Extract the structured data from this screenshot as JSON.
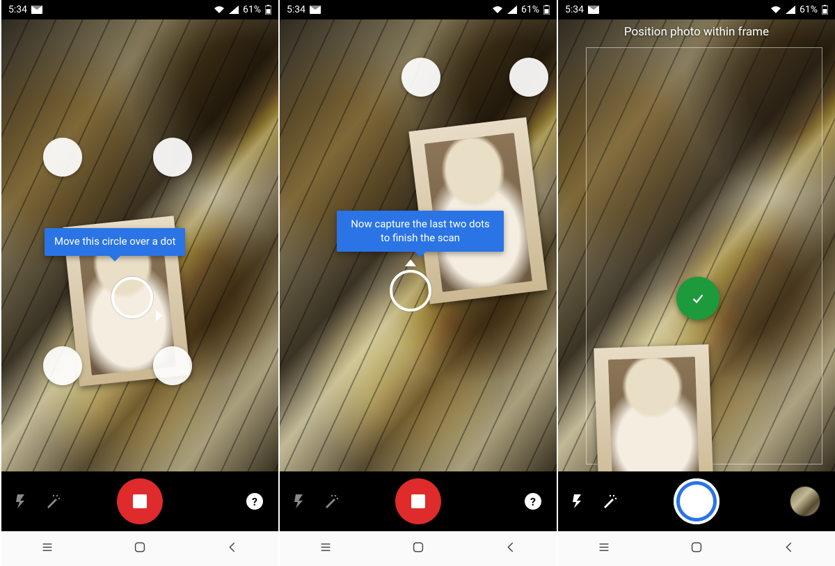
{
  "status": {
    "time": "5:34",
    "battery": "61%"
  },
  "screens": [
    {
      "instruction": "Move this circle over a dot",
      "shutter_mode": "stop",
      "show_help": true,
      "flash_style": "dim",
      "wand_style": "dim"
    },
    {
      "instruction": "Now capture the last two dots to finish the scan",
      "shutter_mode": "stop",
      "show_help": true,
      "flash_style": "dim",
      "wand_style": "dim"
    },
    {
      "instruction": "Position photo within frame",
      "shutter_mode": "ready",
      "show_help": false,
      "flash_style": "bright",
      "wand_style": "bright"
    }
  ],
  "icons": {
    "help_glyph": "?"
  }
}
